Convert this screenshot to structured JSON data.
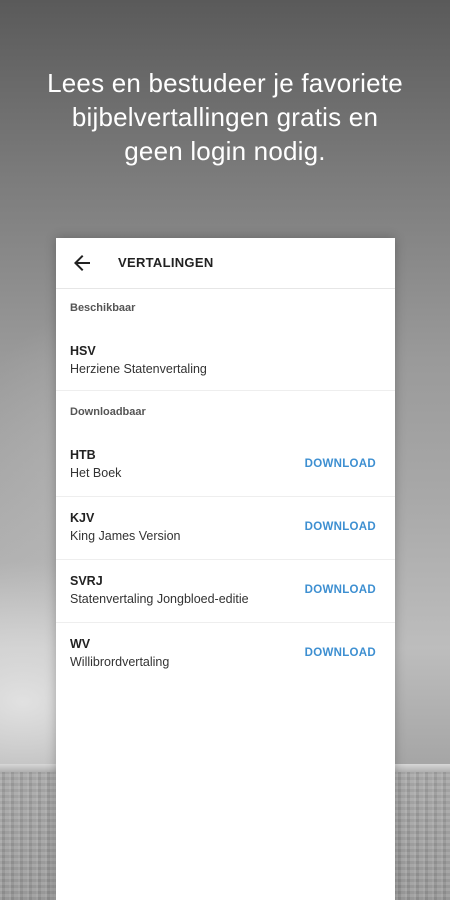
{
  "promo": {
    "lines": [
      "Lees en bestudeer je favoriete",
      "bijbelvertallingen gratis en",
      "geen login nodig."
    ]
  },
  "appbar": {
    "back_icon": "arrow-left-icon",
    "title": "VERTALINGEN"
  },
  "sections": {
    "available_label": "Beschikbaar",
    "downloadable_label": "Downloadbaar"
  },
  "available": [
    {
      "code": "HSV",
      "name": "Herziene Statenvertaling"
    }
  ],
  "downloadable": [
    {
      "code": "HTB",
      "name": "Het Boek",
      "action": "DOWNLOAD"
    },
    {
      "code": "KJV",
      "name": "King James Version",
      "action": "DOWNLOAD"
    },
    {
      "code": "SVRJ",
      "name": "Statenvertaling Jongbloed-editie",
      "action": "DOWNLOAD"
    },
    {
      "code": "WV",
      "name": "Willibrordvertaling",
      "action": "DOWNLOAD"
    }
  ],
  "colors": {
    "accent": "#3d8fd1",
    "card": "#ffffff",
    "text": "#222222"
  }
}
